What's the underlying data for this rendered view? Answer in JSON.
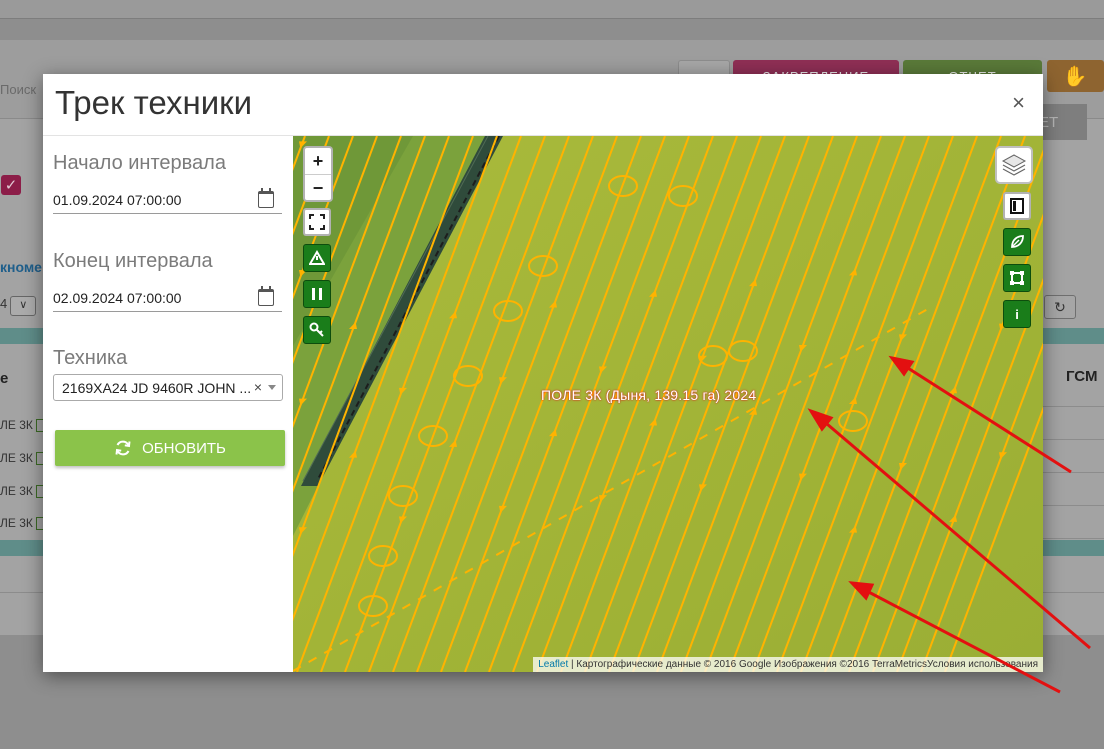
{
  "background": {
    "search_placeholder": "Поиск",
    "buttons": [
      "ЗАКРЕПЛЕНИЕ",
      "ОТЧЕТ"
    ],
    "gray_button": "ЕТ",
    "link_partial": "кноме",
    "select_partial": "4",
    "column_left": "е",
    "column_gsm": "ГСМ",
    "rows": [
      "ЛЕ 3К",
      "ЛЕ 3К",
      "ЛЕ 3К",
      "ЛЕ 3К"
    ]
  },
  "modal": {
    "title": "Трек техники",
    "close_label": "×",
    "start_label": "Начало интервала",
    "start_value": "01.09.2024 07:00:00",
    "end_label": "Конец интервала",
    "end_value": "02.09.2024 07:00:00",
    "vehicle_label": "Техника",
    "vehicle_value": "2169ХА24 JD 9460R JOHN ...",
    "vehicle_clear": "×",
    "update_label": "ОБНОВИТЬ"
  },
  "map": {
    "zoom_in": "+",
    "zoom_out": "−",
    "field_label": "ПОЛЕ 3К (Дыня, 139.15 га) 2024",
    "attribution_link": "Leaflet",
    "attribution_text": " | Картографические данные © 2016 Google Изображения ©2016 TerraMetricsУсловия использования",
    "info_icon_label": "i",
    "colors": {
      "field": "#a9b83a",
      "track": "#ffb300",
      "control_green": "#1a7d1a",
      "annotation_arrow": "#e31010"
    }
  }
}
